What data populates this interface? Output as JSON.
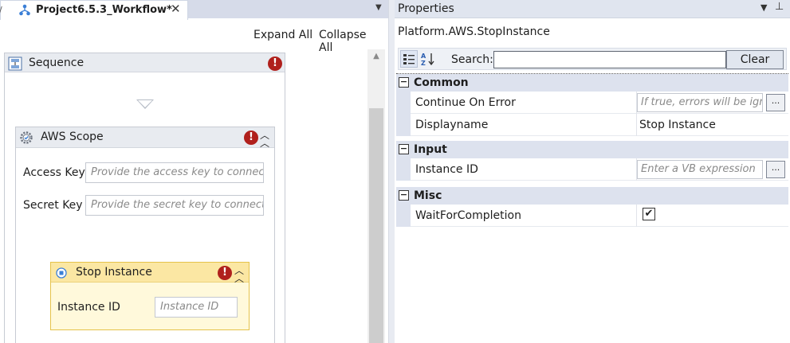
{
  "designer": {
    "tab": {
      "title": "Project6.5.3_Workflow*",
      "close": "✕"
    },
    "tab_dropdown": "▼",
    "expand_all": "Expand All",
    "collapse_all": "Collapse All",
    "sequence": {
      "title": "Sequence",
      "error": "!",
      "aws_scope": {
        "title": "AWS Scope",
        "error": "!",
        "access_key_label": "Access Key",
        "access_key_placeholder": "Provide the access key to connect",
        "secret_key_label": "Secret Key",
        "secret_key_placeholder": "Provide the secret key to connect",
        "stop_instance": {
          "title": "Stop Instance",
          "error": "!",
          "instance_id_label": "Instance ID",
          "instance_id_placeholder": "Instance ID"
        }
      }
    }
  },
  "properties": {
    "title": "Properties",
    "activity_type": "Platform.AWS.StopInstance",
    "search_label": "Search:",
    "search_value": "",
    "clear_label": "Clear",
    "categories": [
      {
        "name": "Common",
        "toggle": "−",
        "props": [
          {
            "name": "Continue On Error",
            "placeholder": "If true, errors will be ignored",
            "has_button": true
          },
          {
            "name": "Displayname",
            "value": "Stop Instance"
          }
        ]
      },
      {
        "name": "Input",
        "toggle": "−",
        "props": [
          {
            "name": "Instance ID",
            "placeholder": "Enter a VB expression",
            "has_button": true
          }
        ]
      },
      {
        "name": "Misc",
        "toggle": "−",
        "props": [
          {
            "name": "WaitForCompletion",
            "checked": true,
            "check_glyph": "✔"
          }
        ]
      }
    ],
    "ellipsis": "..."
  },
  "colors": {
    "error_red": "#b0201c",
    "activity_highlight": "#fbe7a3",
    "category_bg": "#dde2ee"
  }
}
